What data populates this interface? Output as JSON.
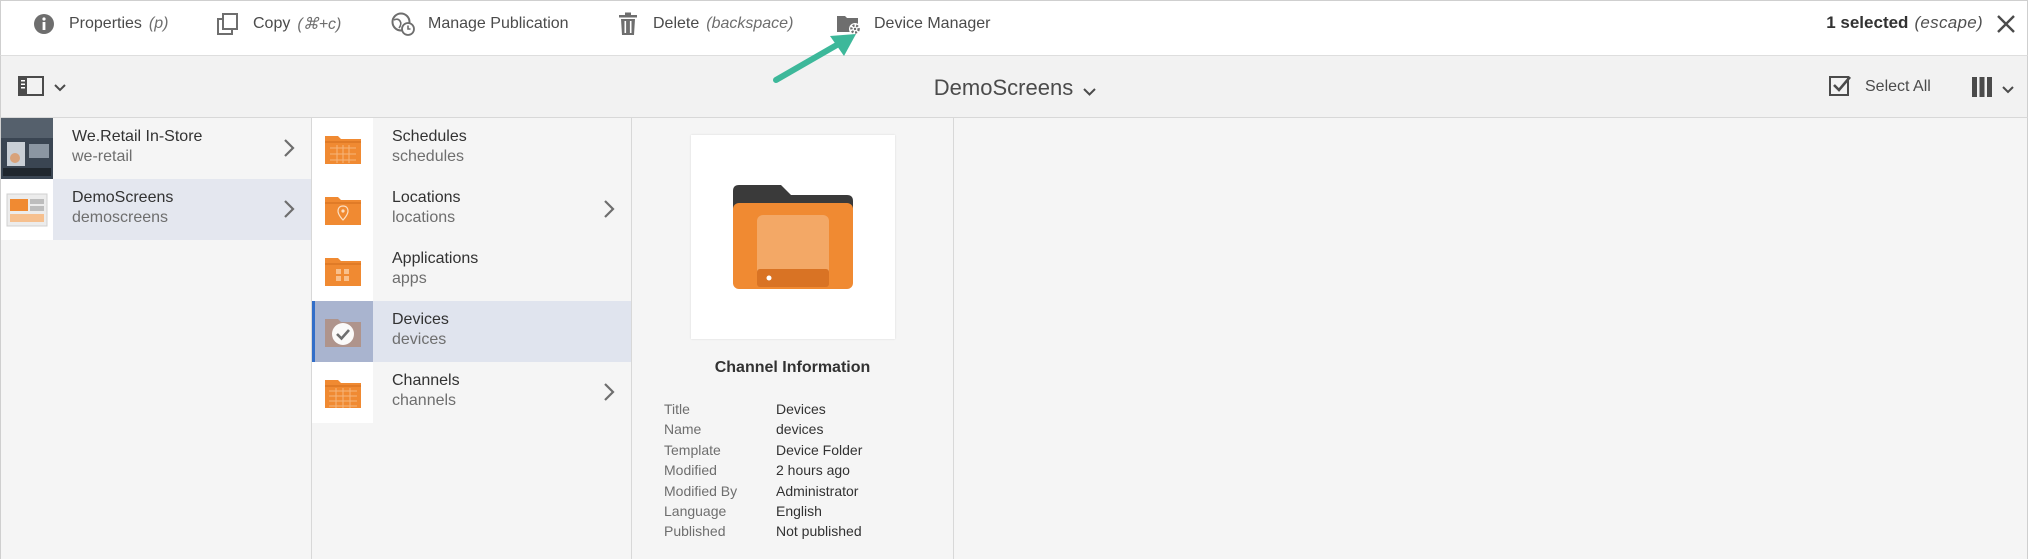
{
  "actionbar": {
    "actions": [
      {
        "label": "Properties",
        "shortcut": "(p)",
        "icon": "info-icon"
      },
      {
        "label": "Copy",
        "shortcut": "(⌘+c)",
        "icon": "copy-icon"
      },
      {
        "label": "Manage Publication",
        "shortcut": "",
        "icon": "globe-clock-icon"
      },
      {
        "label": "Delete",
        "shortcut": "(backspace)",
        "icon": "trash-icon"
      },
      {
        "label": "Device Manager",
        "shortcut": "",
        "icon": "folder-gear-icon"
      }
    ],
    "selection_count": "1 selected",
    "selection_shortcut": "(escape)"
  },
  "header": {
    "title": "DemoScreens",
    "select_all_label": "Select All"
  },
  "columns": {
    "projects": [
      {
        "title": "We.Retail In-Store",
        "name": "we-retail"
      },
      {
        "title": "DemoScreens",
        "name": "demoscreens"
      }
    ],
    "folders": [
      {
        "title": "Schedules",
        "name": "schedules"
      },
      {
        "title": "Locations",
        "name": "locations"
      },
      {
        "title": "Applications",
        "name": "apps"
      },
      {
        "title": "Devices",
        "name": "devices"
      },
      {
        "title": "Channels",
        "name": "channels"
      }
    ]
  },
  "preview": {
    "title": "Channel Information",
    "meta": [
      {
        "key": "Title",
        "value": "Devices"
      },
      {
        "key": "Name",
        "value": "devices"
      },
      {
        "key": "Template",
        "value": "Device Folder"
      },
      {
        "key": "Modified",
        "value": "2 hours ago"
      },
      {
        "key": "Modified By",
        "value": "Administrator"
      },
      {
        "key": "Language",
        "value": "English"
      },
      {
        "key": "Published",
        "value": "Not published"
      }
    ]
  },
  "colors": {
    "accent": "#326ec8",
    "folder_orange": "#f08a32",
    "annotation_arrow": "#3db89a"
  }
}
